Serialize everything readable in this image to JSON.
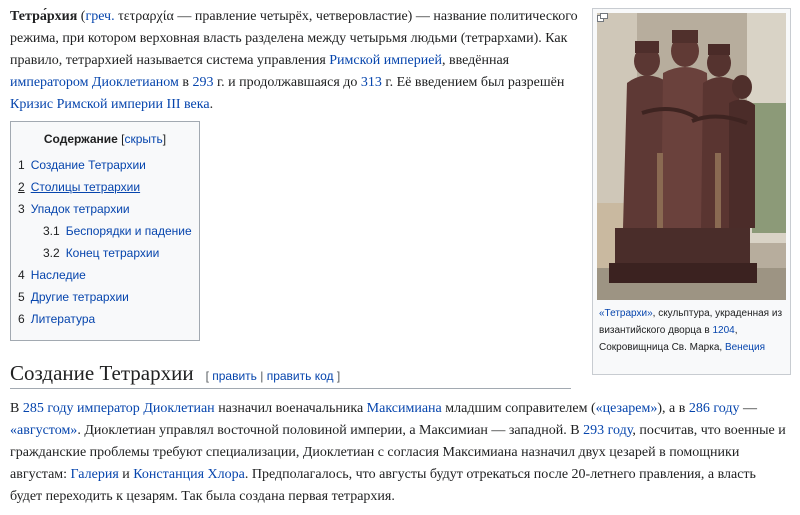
{
  "intro": {
    "title_word": "Тетра́рхия",
    "lp": " (",
    "greek_link": "греч.",
    "greek_word": " τετραρχία",
    "t1": " — правление четырёх, четверовластие) — название политического режима, при котором верховная власть разделена между четырьмя людьми (тетрархами). Как правило, тетрархией называется система управления ",
    "link_rome": "Римской империей",
    "t2": ", введённая ",
    "link_emperor": "императором Диоклетианом",
    "t3": " в ",
    "link_293": "293",
    "t4": " г. и продолжавшаяся до ",
    "link_313": "313",
    "t5": " г. Её введением был разрешён ",
    "link_crisis": "Кризис Римской империи III века",
    "t6": "."
  },
  "toc": {
    "title": "Содержание",
    "toggle_open": " [",
    "toggle": "скрыть",
    "toggle_close": "]",
    "items": [
      {
        "num": "1",
        "label": "Создание Тетрархии"
      },
      {
        "num": "2",
        "label": "Столицы тетрархии"
      },
      {
        "num": "3",
        "label": "Упадок тетрархии"
      },
      {
        "num": "3.1",
        "label": "Беспорядки и падение"
      },
      {
        "num": "3.2",
        "label": "Конец тетрархии"
      },
      {
        "num": "4",
        "label": "Наследие"
      },
      {
        "num": "5",
        "label": "Другие тетрархии"
      },
      {
        "num": "6",
        "label": "Литература"
      }
    ]
  },
  "figure": {
    "caption_link": "«Тетрархи»",
    "caption_text": ", скульптура, украденная из византийского дворца в ",
    "caption_year": "1204",
    "caption_text2": ", Сокровищница Св. Марка, ",
    "caption_city": "Венеция"
  },
  "section": {
    "heading": "Создание Тетрархии",
    "edit_open": "[ ",
    "edit": "править",
    "edit_sep": " | ",
    "edit_code": "править код",
    "edit_close": " ]"
  },
  "para2": {
    "t0": "В ",
    "l1": "285 году",
    "s1": " ",
    "l2": "император",
    "s2": " ",
    "l3": "Диоклетиан",
    "t1": " назначил военачальника ",
    "l4": "Максимиана",
    "t2": " младшим соправителем (",
    "l5": "«цезарем»",
    "t3": "), а в ",
    "l6": "286 году",
    "t4": " — ",
    "l7": "«августом»",
    "t5": ". Диоклетиан управлял восточной половиной империи, а Максимиан — западной. В ",
    "l8": "293 году",
    "t6": ", посчитав, что военные и гражданские проблемы требуют специализации, Диоклетиан с согласия Максимиана назначил двух цезарей в помощники августам: ",
    "l9": "Галерия",
    "t7": " и ",
    "l10": "Констанция Хлора",
    "t8": ". Предполагалось, что августы будут отрекаться после 20-летнего правления, а власть будет переходить к цезарям. Так была создана первая тетрархия."
  }
}
